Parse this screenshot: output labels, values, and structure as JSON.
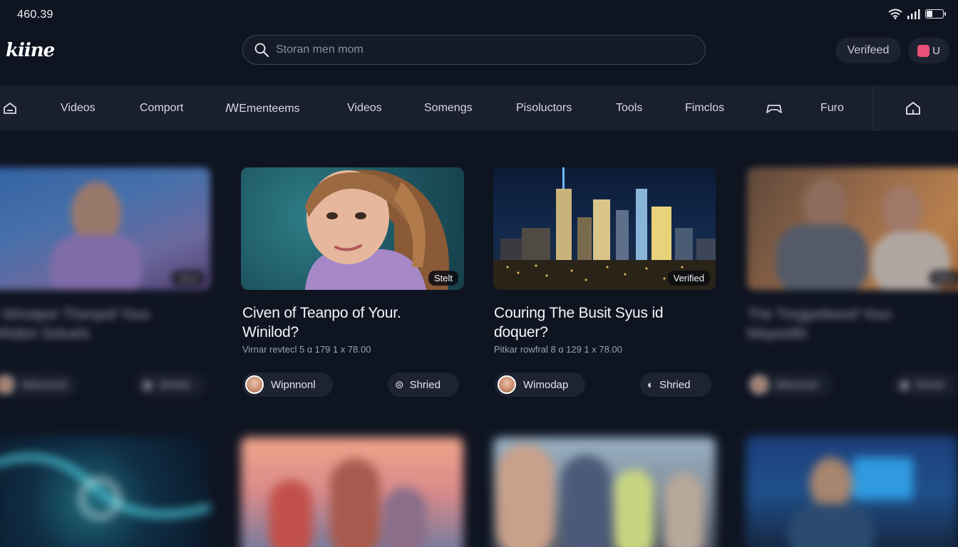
{
  "status": {
    "time": "460.39"
  },
  "header": {
    "logo": "kiine",
    "search_placeholder": "Storan men mom",
    "verified_label": "Verifeed"
  },
  "nav": {
    "items": [
      "Videos",
      "Comport",
      "ꟿEmenteems",
      "Videos",
      "Somengs",
      "Pisoluctors",
      "Tools",
      "Fimclos",
      "Furo"
    ]
  },
  "cards": [
    {
      "title_line1": "r Wnotpor Thenpof Your.",
      "title_line2": "Nhdon Seluels",
      "badge": "Stoei",
      "author": "Wisrenrel",
      "action": "Shrted"
    },
    {
      "title_line1": "Civen of Teanpo of Your.",
      "title_line2": "Winilod?",
      "meta": "Virnar revtecl  5 ɑ 179  1  x  78.00",
      "badge": "Stelt",
      "author": "Wipnnonl",
      "action": "Shried"
    },
    {
      "title_line1": "Couring The Busit Syus id",
      "title_line2": "ɗoquer?",
      "meta": "Pitkar rowfral  8 ɑ 129  1  x  78.00",
      "badge": "Verified",
      "author": "Wimodap",
      "action": "Shried"
    },
    {
      "title_line1": "The Tregpetieeof Your.",
      "title_line2": "Mayeetfo",
      "badge": "Shee",
      "author": "Weennel",
      "action": "Shred"
    }
  ],
  "colors": {
    "background": "#0f1421",
    "nav_bg": "#1a1f2d",
    "chip_bg": "#1e2331",
    "accent": "#e8507a"
  }
}
